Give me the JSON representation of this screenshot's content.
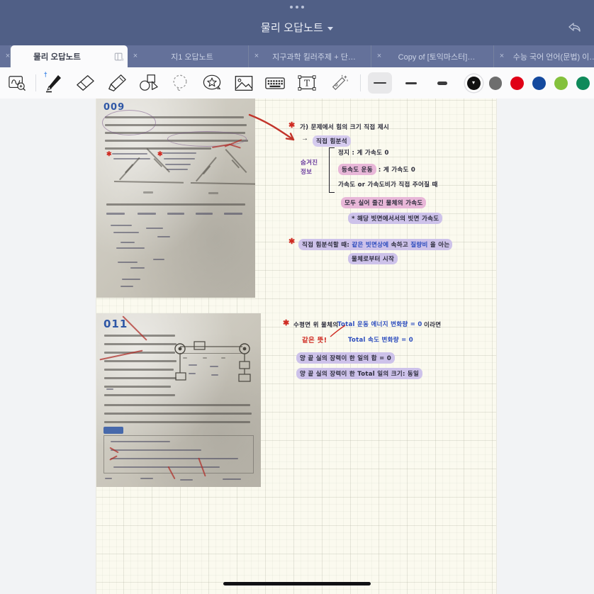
{
  "titlebar": {
    "document_title": "물리 오답노트",
    "caret_icon": "chevron-down-icon",
    "undo_icon": "undo-arrow-icon",
    "menu_dots_icon": "three-dots-icon",
    "bg_color": "#505f86"
  },
  "tabs": [
    {
      "label": "물리 오답노트",
      "active": true,
      "close_label": "x",
      "icon": "book-page-icon"
    },
    {
      "label": "지1 오답노트",
      "active": false,
      "close_label": "x"
    },
    {
      "label": "지구과학 킬러주제 + 단…",
      "active": false,
      "close_label": "x"
    },
    {
      "label": "Copy of [토익마스터]…",
      "active": false,
      "close_label": "x"
    },
    {
      "label": "수능 국어 언어(문법) 이…",
      "active": false,
      "close_label": "x"
    }
  ],
  "toolbar": {
    "tools": [
      {
        "name": "lasso-zoom-icon",
        "label": "Zoom / Magnify selection"
      },
      {
        "name": "pen-icon",
        "label": "Pen",
        "badge": "bluetooth-icon",
        "selected": true
      },
      {
        "name": "eraser-icon",
        "label": "Eraser"
      },
      {
        "name": "highlighter-icon",
        "label": "Highlighter"
      },
      {
        "name": "shapes-icon",
        "label": "Shapes"
      },
      {
        "name": "lasso-select-icon",
        "label": "Lasso select"
      },
      {
        "name": "sticker-icon",
        "label": "Sticker"
      },
      {
        "name": "image-icon",
        "label": "Insert image"
      },
      {
        "name": "keyboard-icon",
        "label": "Keyboard"
      },
      {
        "name": "text-box-icon",
        "label": "Text box"
      },
      {
        "name": "magic-wand-icon",
        "label": "Magic tool"
      }
    ],
    "stroke_widths": [
      {
        "name": "stroke-thin",
        "selected": true,
        "px": 2
      },
      {
        "name": "stroke-medium",
        "selected": false,
        "px": 3
      },
      {
        "name": "stroke-thick",
        "selected": false,
        "px": 5
      }
    ],
    "colors": [
      {
        "name": "color-black",
        "hex": "#111111",
        "selected": true
      },
      {
        "name": "color-gray",
        "hex": "#6e6e6e",
        "selected": false
      },
      {
        "name": "color-red",
        "hex": "#e00016",
        "selected": false
      },
      {
        "name": "color-blue",
        "hex": "#14499e",
        "selected": false
      },
      {
        "name": "color-light-green",
        "hex": "#84c13c",
        "selected": false
      },
      {
        "name": "color-dark-green",
        "hex": "#0f8a5a",
        "selected": false
      }
    ]
  },
  "page": {
    "bg_color": "#fbfaef",
    "grid": "10px minor / 40px major",
    "clippings": [
      {
        "name": "physics-problem-photo-009",
        "page_number": "009"
      },
      {
        "name": "physics-problem-photo-011",
        "page_number": "011"
      }
    ]
  },
  "notes": {
    "block1": {
      "line1": "가) 문제에서 힘의 크기 직접 제시",
      "line2_arrow": "→",
      "line2": "직접 힘분석",
      "side_label_1": "숨겨진",
      "side_label_2": "정보",
      "item1": "정지 : 계 가속도 0",
      "item2_hl": "등속도 운동",
      "item2_rest": ": 계 가속도 0",
      "item3": "가속도 or 가속도비가 직접 주어질 때",
      "item4": "모두 실어 줄긴 물체의 가속도",
      "item5": "* 해당 빗면에서서의 빗면 가속도",
      "bottom_star": "직접 힘분석할 때:",
      "bottom_blue": "같은 빗면상에",
      "bottom_mid": "속하고",
      "bottom_blue2": "질량비",
      "bottom_end": "을 아는",
      "bottom_line2": "물체로부터 시작"
    },
    "block2": {
      "line1": "수평면 위 물체의",
      "line1_blue": "Total 운동 에너지 변화량 = 0",
      "line1_end": "이라면",
      "red_note": "같은 뜻!",
      "line2_blue": "Total 속도 변화량 = 0",
      "line3": "양 끝 실의 장력이 한 일의 합 = 0",
      "line4": "양 끝 실의 장력이 한 Total 일의 크기: 동일"
    }
  },
  "bottom": {
    "home_indicator": "home-bar"
  }
}
